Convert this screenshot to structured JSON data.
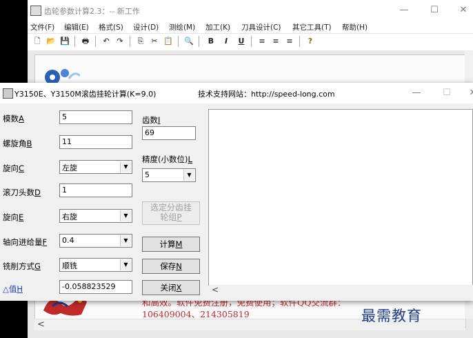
{
  "main_window": {
    "title": "齿轮参数计算2.3：-- 新工作",
    "controls": {
      "minimize": "—",
      "maximize": "☐",
      "close": "✕"
    },
    "menu": [
      "文件(F)",
      "编辑(E)",
      "格式(S)",
      "设计(D)",
      "测绘(M)",
      "加工(K)",
      "刀具设计(C)",
      "其它工具(T)",
      "帮助(H)"
    ],
    "toolbar": {
      "new": "🗋",
      "open": "📂",
      "save": "💾",
      "print": "🖶",
      "undo": "↶",
      "redo": "↷",
      "copy": "⎘",
      "cut": "✂",
      "paste": "📋",
      "find": "🔍",
      "bold": "B",
      "italic": "I",
      "underline": "U",
      "align_left": "≡",
      "align_center": "≡",
      "align_right": "≡",
      "help": "?"
    },
    "doc_text_line1": "和高效。软件免费注册，免费使用；软件QQ交流群：",
    "doc_text_line2": "106409004、214305819",
    "watermark": "最需教育"
  },
  "calc_dialog": {
    "title": "Y3150E、Y3150M滚齿挂轮计算(K=9.0)",
    "support_site": "技术支持网站：http://speed-long.com",
    "controls": {
      "minimize": "—",
      "maximize": "☐",
      "close": "✕"
    },
    "labels": {
      "module": "模数",
      "module_key": "A",
      "helix": "螺旋角",
      "helix_key": "B",
      "rotation": "旋向",
      "rotation_key": "C",
      "hob_starts": "滚刀头数",
      "hob_starts_key": "D",
      "rotation2": "旋向",
      "rotation2_key": "E",
      "feed": "轴向进给量",
      "feed_key": "F",
      "milling": "铣削方式",
      "milling_key": "G",
      "delta": "△值",
      "delta_key": "H",
      "teeth": "齿数",
      "teeth_key": "I",
      "precision": "精度(小数位)",
      "precision_key": "L"
    },
    "values": {
      "module": "5",
      "helix": "11",
      "rotation": "左旋",
      "hob_starts": "1",
      "rotation2": "右旋",
      "feed": "0.4",
      "milling": "顺铣",
      "delta": "-0.058823529",
      "teeth": "69",
      "precision": "5"
    },
    "buttons": {
      "select_gear_line1": "选定分齿挂",
      "select_gear_line2": "轮组",
      "select_gear_key": "P",
      "calculate": "计算",
      "calculate_key": "M",
      "save": "保存",
      "save_key": "N",
      "close": "关闭",
      "close_key": "X"
    },
    "dropdown_arrow": "▼",
    "scroll_left": "<"
  }
}
